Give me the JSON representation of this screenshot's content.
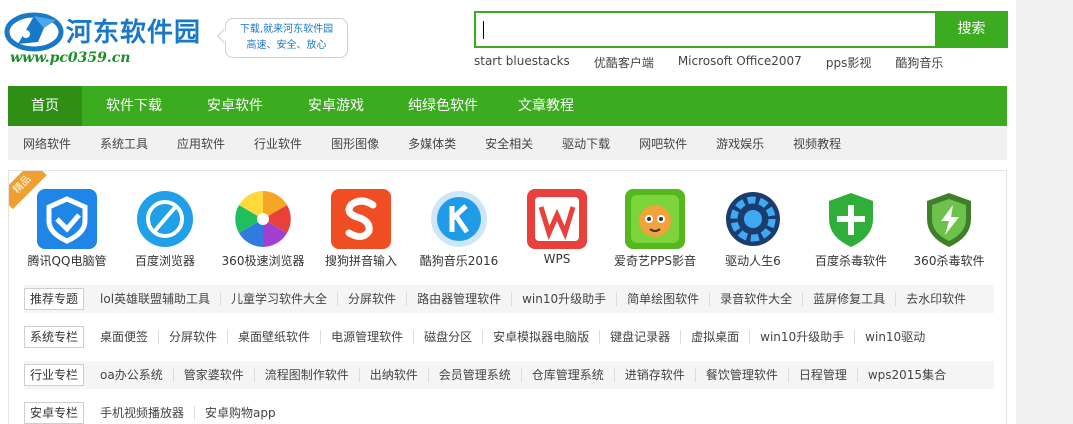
{
  "header": {
    "logo_title": "河东软件园",
    "logo_url": "www.pc0359.cn",
    "slogan_line1": "下载,就来河东软件园",
    "slogan_line2": "高速、安全、放心"
  },
  "search": {
    "value": "",
    "button_label": "搜索",
    "hot_words": [
      "start bluestacks",
      "优酷客户端",
      "Microsoft Office2007",
      "pps影视",
      "酷狗音乐"
    ]
  },
  "main_nav": [
    "首页",
    "软件下载",
    "安卓软件",
    "安卓游戏",
    "纯绿色软件",
    "文章教程"
  ],
  "sub_nav": [
    "网络软件",
    "系统工具",
    "应用软件",
    "行业软件",
    "图形图像",
    "多媒体类",
    "安全相关",
    "驱动下载",
    "网吧软件",
    "游戏娱乐",
    "视频教程"
  ],
  "featured": {
    "ribbon": "精品",
    "apps": [
      {
        "label": "腾讯QQ电脑管",
        "icon": "qq-pc-manager-icon"
      },
      {
        "label": "百度浏览器",
        "icon": "baidu-browser-icon"
      },
      {
        "label": "360极速浏览器",
        "icon": "360-speed-browser-icon"
      },
      {
        "label": "搜狗拼音输入",
        "icon": "sogou-pinyin-icon"
      },
      {
        "label": "酷狗音乐2016",
        "icon": "kugou-music-icon"
      },
      {
        "label": "WPS",
        "icon": "wps-icon"
      },
      {
        "label": "爱奇艺PPS影音",
        "icon": "iqiyi-pps-icon"
      },
      {
        "label": "驱动人生6",
        "icon": "driver-life-icon"
      },
      {
        "label": "百度杀毒软件",
        "icon": "baidu-antivirus-icon"
      },
      {
        "label": "360杀毒软件",
        "icon": "360-antivirus-icon"
      }
    ]
  },
  "tag_rows": [
    {
      "label": "推荐专题",
      "items": [
        "lol英雄联盟辅助工具",
        "儿童学习软件大全",
        "分屏软件",
        "路由器管理软件",
        "win10升级助手",
        "简单绘图软件",
        "录音软件大全",
        "蓝屏修复工具",
        "去水印软件"
      ]
    },
    {
      "label": "系统专栏",
      "items": [
        "桌面便签",
        "分屏软件",
        "桌面壁纸软件",
        "电源管理软件",
        "磁盘分区",
        "安卓模拟器电脑版",
        "键盘记录器",
        "虚拟桌面",
        "win10升级助手",
        "win10驱动"
      ]
    },
    {
      "label": "行业专栏",
      "items": [
        "oa办公系统",
        "管家婆软件",
        "流程图制作软件",
        "出纳软件",
        "会员管理系统",
        "仓库管理系统",
        "进销存软件",
        "餐饮管理软件",
        "日程管理",
        "wps2015集合"
      ]
    },
    {
      "label": "安卓专栏",
      "items": [
        "手机视频播放器",
        "安卓购物app"
      ]
    }
  ],
  "colors": {
    "brand_green": "#3bab1f",
    "nav_active": "#2e8f14",
    "logo_blue": "#1a78c8",
    "ribbon_orange": "#f0a030"
  }
}
